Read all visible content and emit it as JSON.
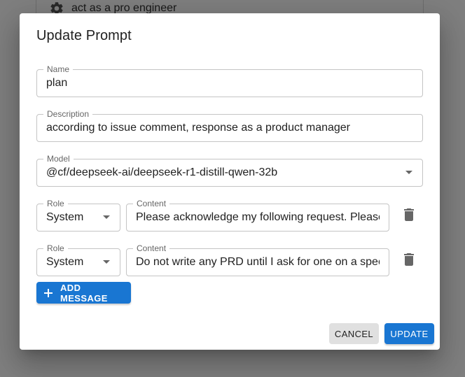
{
  "background": {
    "item_label": "act as a pro engineer",
    "item_icon": "gear-icon"
  },
  "dialog": {
    "title": "Update Prompt",
    "name": {
      "label": "Name",
      "value": "plan"
    },
    "description": {
      "label": "Description",
      "value": "according to issue comment, response as a product manager"
    },
    "model": {
      "label": "Model",
      "value": "@cf/deepseek-ai/deepseek-r1-distill-qwen-32b"
    },
    "messages": [
      {
        "role_label": "Role",
        "role": "System",
        "content_label": "Content",
        "content": "Please acknowledge my following request. Please respond to me as a product manager."
      },
      {
        "role_label": "Role",
        "role": "System",
        "content_label": "Content",
        "content": "Do not write any PRD until I ask for one on a specific subject."
      }
    ],
    "add_message_label": "ADD MESSAGE",
    "cancel_label": "CANCEL",
    "update_label": "UPDATE"
  },
  "colors": {
    "primary": "#1976d2",
    "backdrop": "rgba(0,0,0,0.5)",
    "cancel_bg": "#e0e0e0"
  }
}
